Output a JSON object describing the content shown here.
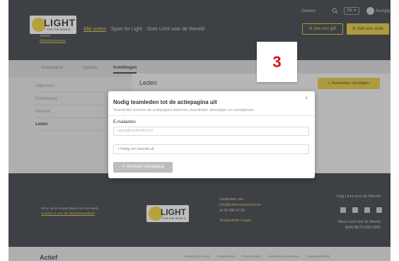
{
  "header": {
    "logo_word": "LIGHT",
    "logo_sub": "FOR THE WORLD",
    "org_line": "Samen",
    "org_name": "Actiedeelnemers",
    "nav": [
      "Alle acties",
      "Sport for Light",
      "Over Licht voor de Wereld"
    ],
    "search_label": "Zoeken",
    "language": "NL ▾",
    "user_name": "Sumpty",
    "gift_button": "Ik doe een gift",
    "start_button": "Ik start een actie"
  },
  "tabs": [
    "Actiepagina",
    "Updates",
    "Instellingen"
  ],
  "sidebar": [
    "Algemeen",
    "Doelbedrag",
    "Neveral",
    "Leden"
  ],
  "card": {
    "title": "Leden",
    "button": "+ Teamleden uitnodigen"
  },
  "modal": {
    "title": "Nodig teamleden tot de actiepagina uit",
    "close": "×",
    "description": "Teamleden kunnen de actiepagina beheren, teamleden uitnodigen en verwijderen.",
    "email_label": "E-mailadres",
    "email_placeholder": "naam@voorbeeld.com",
    "invite_more": "+ Nodig een teamlid uit",
    "send_button": "✐ Verstuur uitnodiging"
  },
  "step_number": "3",
  "footer": {
    "left_text": "Wil je op de hoogte blijven van ons werk,",
    "left_link": "schrijf je in voor de Wereldnieuwsbrief",
    "contact_title": "Contacteer ons",
    "contact_email": "info@lichtvoordewereld.be",
    "contact_phone": "tel 00 495 97 09",
    "faq": "Veelgestelde vragen",
    "follow": "Volg Licht voor de Wereld",
    "address_line1": "Steun Licht voor de Wereld",
    "address_line2": "IBAN BE78 0000 0000"
  },
  "bottom": {
    "logo": "Actief",
    "links": [
      "Powered by Actief",
      "Cookiebeleid",
      "Privacybeleid",
      "Gebruiksvoorwaarden",
      "Toegankelijkheid"
    ]
  }
}
